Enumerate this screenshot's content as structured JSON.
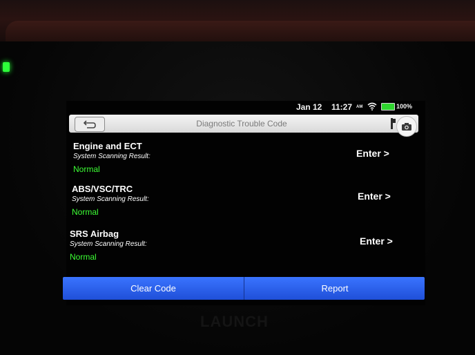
{
  "status": {
    "date": "Jan 12",
    "time": "11:27",
    "ampm": "AM",
    "battery": "100%"
  },
  "header": {
    "title": "Diagnostic Trouble Code"
  },
  "systems": [
    {
      "name": "Engine and ECT",
      "scan_label": "System Scanning Result:",
      "status": "Normal",
      "action": "Enter >"
    },
    {
      "name": "ABS/VSC/TRC",
      "scan_label": "System Scanning Result:",
      "status": "Normal",
      "action": "Enter >"
    },
    {
      "name": "SRS Airbag",
      "scan_label": "System Scanning Result:",
      "status": "Normal",
      "action": "Enter >"
    }
  ],
  "footer": {
    "clear_label": "Clear Code",
    "report_label": "Report"
  },
  "brand": {
    "logo_text": "LAUNCH"
  },
  "colors": {
    "status_normal": "#3dff35",
    "button_blue": "#2b5ff0",
    "battery_green": "#2fd62f"
  },
  "icons": {
    "back": "back-arrow-icon",
    "flag": "flag-icon",
    "camera": "camera-icon",
    "wifi": "wifi-icon",
    "battery": "battery-icon"
  }
}
